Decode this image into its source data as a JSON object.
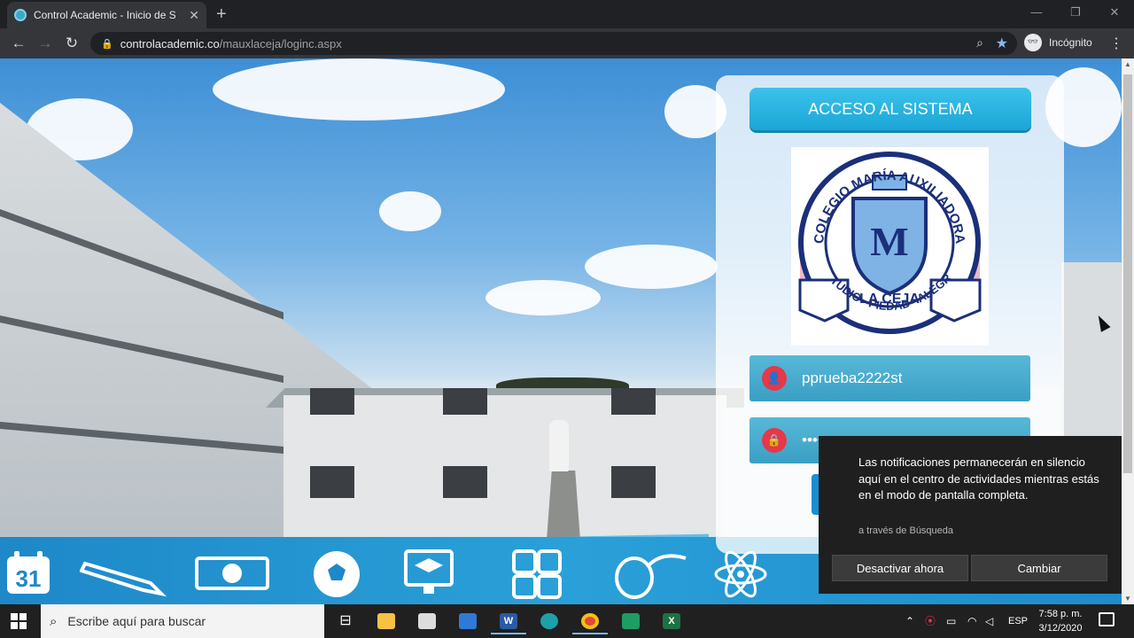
{
  "browser": {
    "tab_title": "Control Academic - Inicio de Sesión",
    "tab_close": "✕",
    "new_tab": "+",
    "url_host": "controlacademic.co",
    "url_path": "/mauxlaceja/loginc.aspx",
    "profile_label": "Incógnito",
    "window_minimize": "—",
    "window_restore": "❐",
    "window_close": "✕"
  },
  "login": {
    "header": "ACCESO AL SISTEMA",
    "username": "pprueba2222st",
    "password_mask": "••••",
    "logo": {
      "top_text": "COLEGIO MARÍA AUXILIADORA",
      "bottom_text": "ESTUDIO - PIEDAD - ALEGRÍA",
      "city": "LA CEJA",
      "colors": {
        "navy": "#1b2f7a",
        "light_blue": "#7fb2e5",
        "pink": "#e9a7b7"
      }
    }
  },
  "icon_strip": {
    "items": [
      "calendar-icon",
      "pencil-icon",
      "money-icon",
      "soccer-ball-icon",
      "computer-graduation-icon",
      "calculator-icon",
      "mouse-icon",
      "atom-icon"
    ],
    "calendar_day": "31"
  },
  "toast": {
    "message": "Las notificaciones permanecerán en silencio aquí en el centro de actividades mientras estás en el modo de pantalla completa.",
    "source": "a través de Búsqueda",
    "primary_button": "Desactivar ahora",
    "secondary_button": "Cambiar"
  },
  "taskbar": {
    "search_placeholder": "Escribe aquí para buscar",
    "language": "ESP",
    "time": "7:58 p. m.",
    "date": "3/12/2020"
  },
  "colors": {
    "accent": "#1aa6d6",
    "field_bg": "#3a9fc4",
    "field_icon": "#e5384a",
    "strip_bg": "#1e88c8"
  }
}
